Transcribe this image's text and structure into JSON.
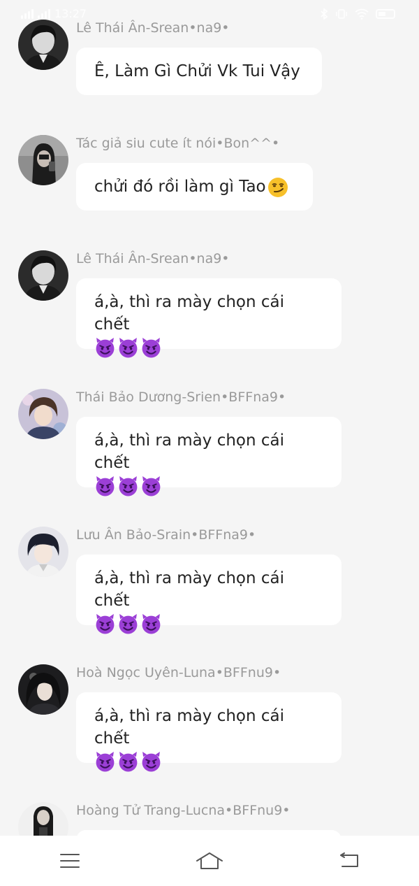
{
  "status_bar": {
    "time": "13:27",
    "battery_level": 0.5,
    "icons": [
      "signal-icon",
      "bluetooth-icon",
      "vibrate-icon",
      "wifi-icon",
      "battery-icon"
    ]
  },
  "messages": [
    {
      "sender": "Lê Thái Ân-Srean•na9•",
      "text": "Ê, Làm Gì Chửi Vk Tui Vậy",
      "emoji": []
    },
    {
      "sender": "Tác giả siu cute ít nói•Bon^^•",
      "text": "chửi đó rồi làm gì Tao",
      "emoji": [
        "smirk"
      ]
    },
    {
      "sender": "Lê Thái Ân-Srean•na9•",
      "text": "á,à, thì ra mày chọn cái chết",
      "emoji": [
        "devil",
        "devil",
        "devil"
      ]
    },
    {
      "sender": "Thái Bảo Dương-Srien•BFFna9•",
      "text": "á,à, thì ra mày chọn cái chết",
      "emoji": [
        "devil",
        "devil",
        "devil"
      ]
    },
    {
      "sender": "Lưu Ân Bảo-Srain•BFFna9•",
      "text": "á,à, thì ra mày chọn cái chết",
      "emoji": [
        "devil",
        "devil",
        "devil"
      ]
    },
    {
      "sender": "Hoà Ngọc Uyên-Luna•BFFnu9•",
      "text": "á,à, thì ra mày chọn cái chết",
      "emoji": [
        "devil",
        "devil",
        "devil"
      ]
    },
    {
      "sender": "Hoàng Tử Trang-Lucna•BFFnu9•",
      "text": "",
      "emoji": []
    }
  ],
  "nav": {
    "items": [
      "menu-icon",
      "home-icon",
      "back-icon"
    ]
  },
  "colors": {
    "background": "#f5f5f5",
    "bubble": "#ffffff",
    "name": "#9a9a9a",
    "text": "#222222",
    "devil": "#9b3fd6"
  }
}
